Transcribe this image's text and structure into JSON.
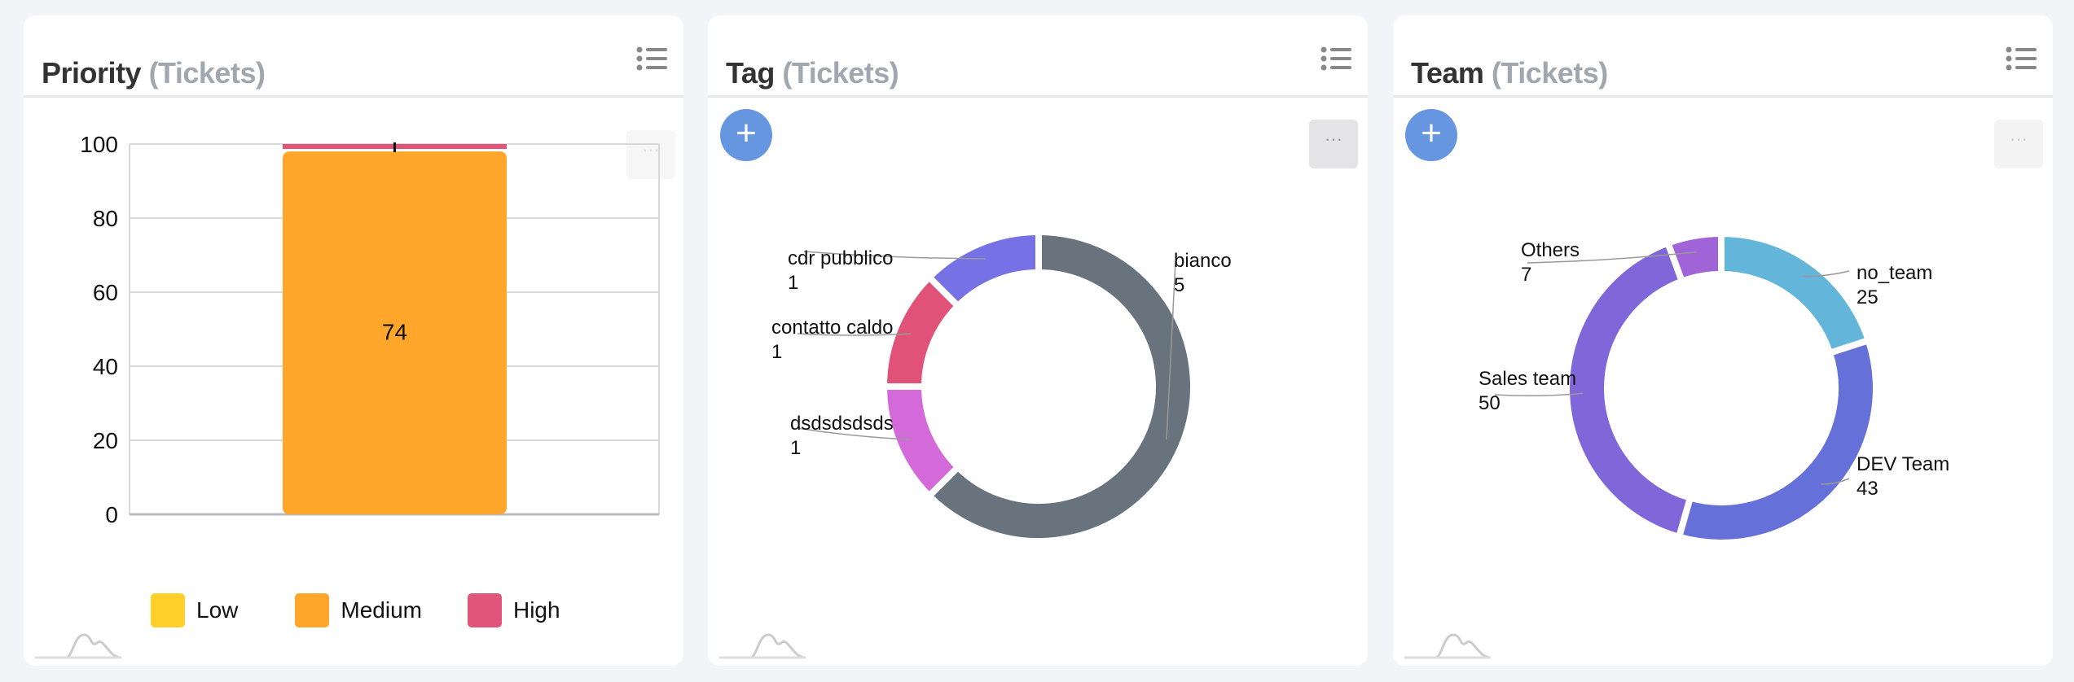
{
  "panels": [
    {
      "title": "Priority",
      "subtitle": "(Tickets)"
    },
    {
      "title": "Tag",
      "subtitle": "(Tickets)"
    },
    {
      "title": "Team",
      "subtitle": "(Tickets)"
    }
  ],
  "buttons": {
    "plus": "+",
    "more": "···"
  },
  "icons": {
    "list": "list-icon",
    "add": "plus-icon",
    "more": "more-horizontal-icon",
    "logo": "mountain-logo-icon"
  },
  "chart_data": [
    {
      "type": "bar",
      "stacking": "percent",
      "categories": [
        ""
      ],
      "series": [
        {
          "name": "Low",
          "values": [
            0
          ],
          "color": "#ffd02a"
        },
        {
          "name": "Medium",
          "values": [
            74
          ],
          "color": "#ffa62b"
        },
        {
          "name": "High",
          "values": [
            1
          ],
          "color": "#e0557a"
        }
      ],
      "data_labels": [
        "74"
      ],
      "yticks": [
        "0",
        "20",
        "40",
        "60",
        "80",
        "100"
      ],
      "ylim": [
        0,
        100
      ],
      "grid": true,
      "legend": "bottom"
    },
    {
      "type": "pie",
      "donut": true,
      "slices": [
        {
          "label": "bianco",
          "value": 5,
          "color": "#68737d"
        },
        {
          "label": "dsdsdsdsds",
          "value": 1,
          "color": "#d46ad9"
        },
        {
          "label": "contatto caldo",
          "value": 1,
          "color": "#e05277"
        },
        {
          "label": "cdr pubblico",
          "value": 1,
          "color": "#7672e6"
        }
      ]
    },
    {
      "type": "pie",
      "donut": true,
      "slices": [
        {
          "label": "no_team",
          "value": 25,
          "color": "#64b5da"
        },
        {
          "label": "DEV Team",
          "value": 43,
          "color": "#6670d9"
        },
        {
          "label": "Sales team",
          "value": 50,
          "color": "#7f66d9"
        },
        {
          "label": "Others",
          "value": 7,
          "color": "#a063d8"
        }
      ]
    }
  ]
}
